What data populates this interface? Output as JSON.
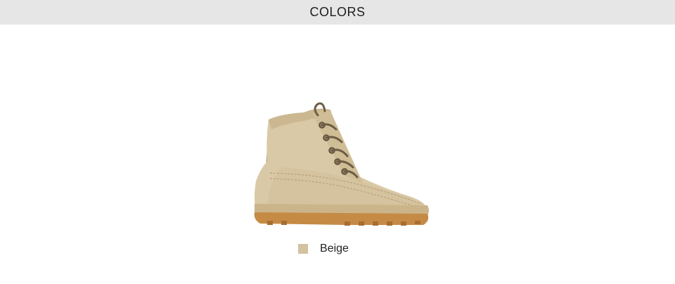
{
  "header": {
    "title": "COLORS"
  },
  "product": {
    "image_icon": "beige-boot-image"
  },
  "colors": [
    {
      "name": "Beige",
      "swatch_color": "#d2c2a0"
    }
  ]
}
